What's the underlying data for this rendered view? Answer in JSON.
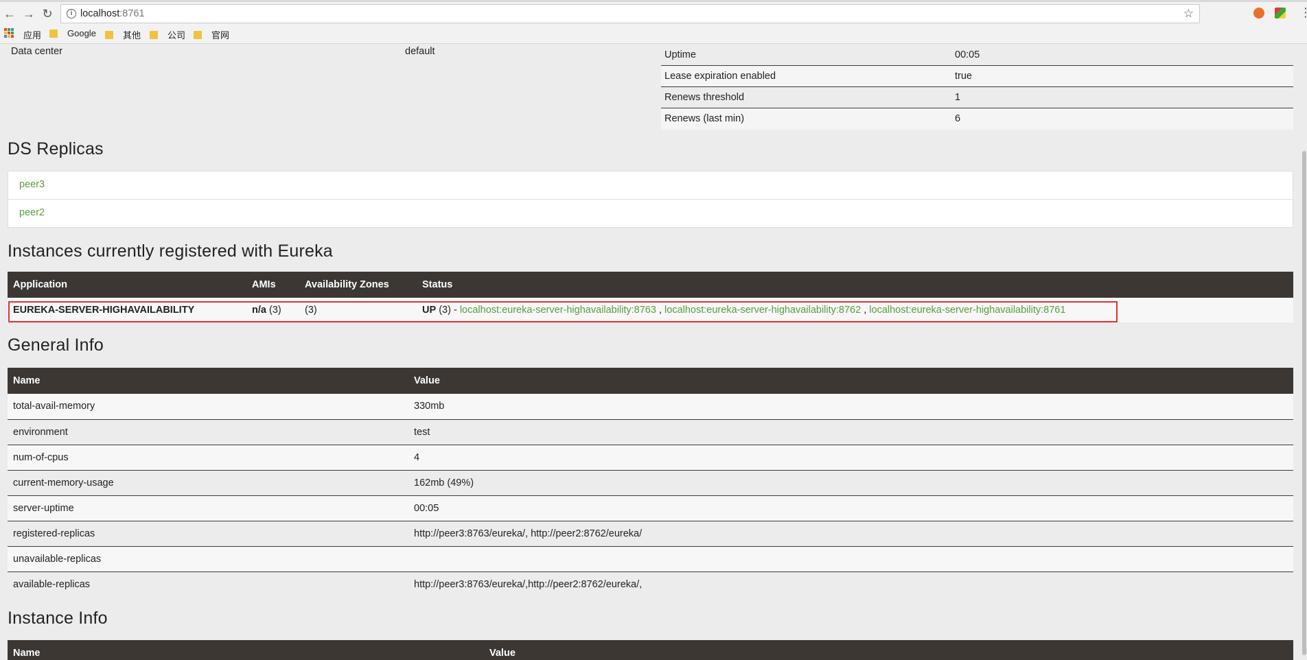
{
  "browser": {
    "url_host": "localhost",
    "url_port": ":8761",
    "bookmarks": [
      "应用",
      "Google",
      "其他",
      "公司",
      "官网"
    ]
  },
  "status_left": {
    "label": "Data center",
    "value": "default"
  },
  "status_right": [
    {
      "name": "Uptime",
      "value": "00:05"
    },
    {
      "name": "Lease expiration enabled",
      "value": "true"
    },
    {
      "name": "Renews threshold",
      "value": "1"
    },
    {
      "name": "Renews (last min)",
      "value": "6"
    }
  ],
  "ds_replicas": {
    "title": "DS Replicas",
    "items": [
      "peer3",
      "peer2"
    ]
  },
  "instances": {
    "title": "Instances currently registered with Eureka",
    "headers": [
      "Application",
      "AMIs",
      "Availability Zones",
      "Status"
    ],
    "row": {
      "application": "EUREKA-SERVER-HIGHAVAILABILITY",
      "amis_value": "n/a",
      "amis_count": "(3)",
      "zones": "(3)",
      "status_state": "UP",
      "status_count": "(3) -",
      "links": [
        "localhost:eureka-server-highavailability:8763",
        "localhost:eureka-server-highavailability:8762",
        "localhost:eureka-server-highavailability:8761"
      ],
      "separator": ","
    }
  },
  "general_info": {
    "title": "General Info",
    "headers": [
      "Name",
      "Value"
    ],
    "rows": [
      {
        "name": "total-avail-memory",
        "value": "330mb"
      },
      {
        "name": "environment",
        "value": "test"
      },
      {
        "name": "num-of-cpus",
        "value": "4"
      },
      {
        "name": "current-memory-usage",
        "value": "162mb (49%)"
      },
      {
        "name": "server-uptime",
        "value": "00:05"
      },
      {
        "name": "registered-replicas",
        "value": "http://peer3:8763/eureka/, http://peer2:8762/eureka/"
      },
      {
        "name": "unavailable-replicas",
        "value": ""
      },
      {
        "name": "available-replicas",
        "value": "http://peer3:8763/eureka/,http://peer2:8762/eureka/,"
      }
    ]
  },
  "instance_info": {
    "title": "Instance Info",
    "headers": [
      "Name",
      "Value"
    ]
  }
}
